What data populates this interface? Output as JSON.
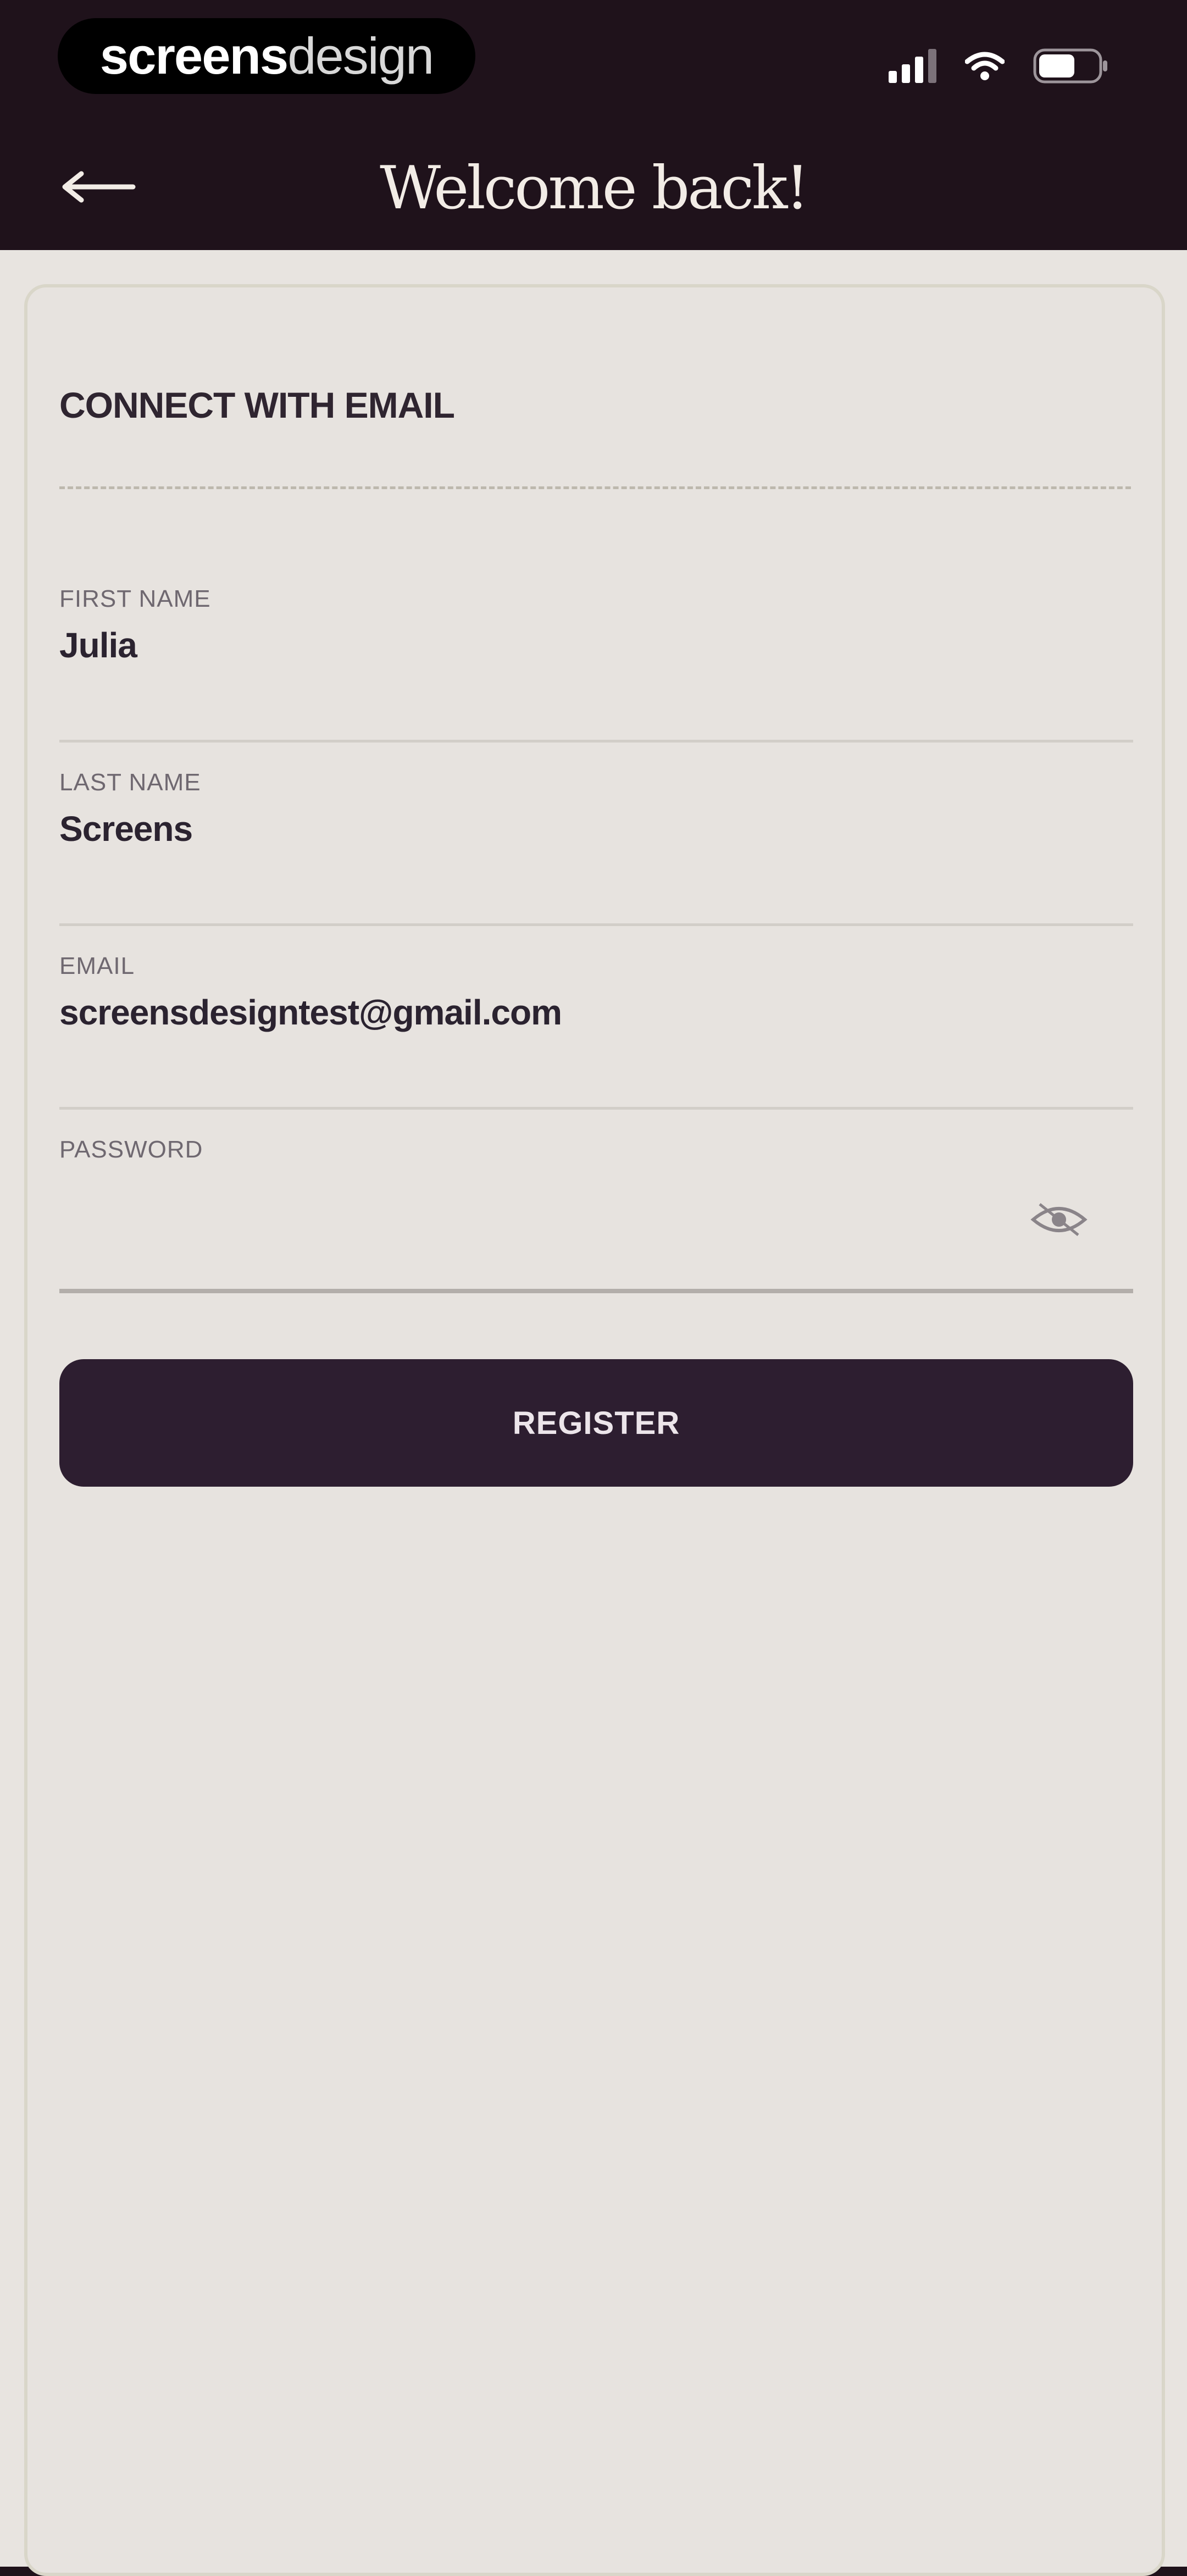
{
  "status_bar": {
    "brand_bold": "screens",
    "brand_light": "design",
    "icons": [
      "signal-icon",
      "wifi-icon",
      "battery-icon"
    ]
  },
  "nav": {
    "title": "Welcome back!",
    "back_icon": "back-arrow-icon"
  },
  "form": {
    "section_title": "CONNECT WITH EMAIL",
    "fields": [
      {
        "label": "FIRST NAME",
        "value": "Julia"
      },
      {
        "label": "LAST NAME",
        "value": "Screens"
      },
      {
        "label": "EMAIL",
        "value": "screensdesigntest@gmail.com"
      },
      {
        "label": "PASSWORD",
        "value": "",
        "icon": "eye-icon"
      }
    ],
    "register_label": "REGISTER"
  },
  "colors": {
    "header_bg": "#1f121b",
    "page_bg": "#e8e4e0",
    "primary_button": "#2d1e30",
    "text_dark": "#2b2330"
  }
}
